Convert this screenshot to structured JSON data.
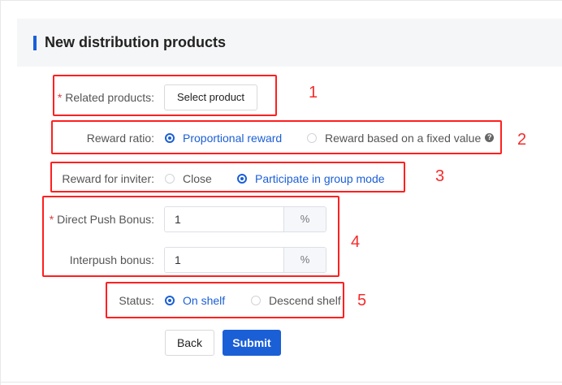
{
  "page": {
    "title": "New distribution products"
  },
  "form": {
    "related_products": {
      "label": "Related products:",
      "required_mark": "*",
      "button": "Select product"
    },
    "reward_ratio": {
      "label": "Reward ratio:",
      "options": [
        {
          "label": "Proportional reward",
          "selected": true
        },
        {
          "label": "Reward based on a fixed value",
          "selected": false
        }
      ],
      "help_icon": "question-circle-icon"
    },
    "reward_inviter": {
      "label": "Reward for inviter:",
      "options": [
        {
          "label": "Close",
          "selected": false
        },
        {
          "label": "Participate in group mode",
          "selected": true
        }
      ]
    },
    "direct_push_bonus": {
      "label": "Direct Push Bonus:",
      "required_mark": "*",
      "value": "1",
      "suffix": "%"
    },
    "interpush_bonus": {
      "label": "Interpush bonus:",
      "value": "1",
      "suffix": "%"
    },
    "status": {
      "label": "Status:",
      "options": [
        {
          "label": "On shelf",
          "selected": true
        },
        {
          "label": "Descend shelf",
          "selected": false
        }
      ]
    },
    "actions": {
      "back": "Back",
      "submit": "Submit"
    }
  },
  "annotations": [
    "1",
    "2",
    "3",
    "4",
    "5"
  ],
  "colors": {
    "accent": "#1b5fd6",
    "annotation": "#ff1f1f",
    "required": "#e23b3b"
  }
}
